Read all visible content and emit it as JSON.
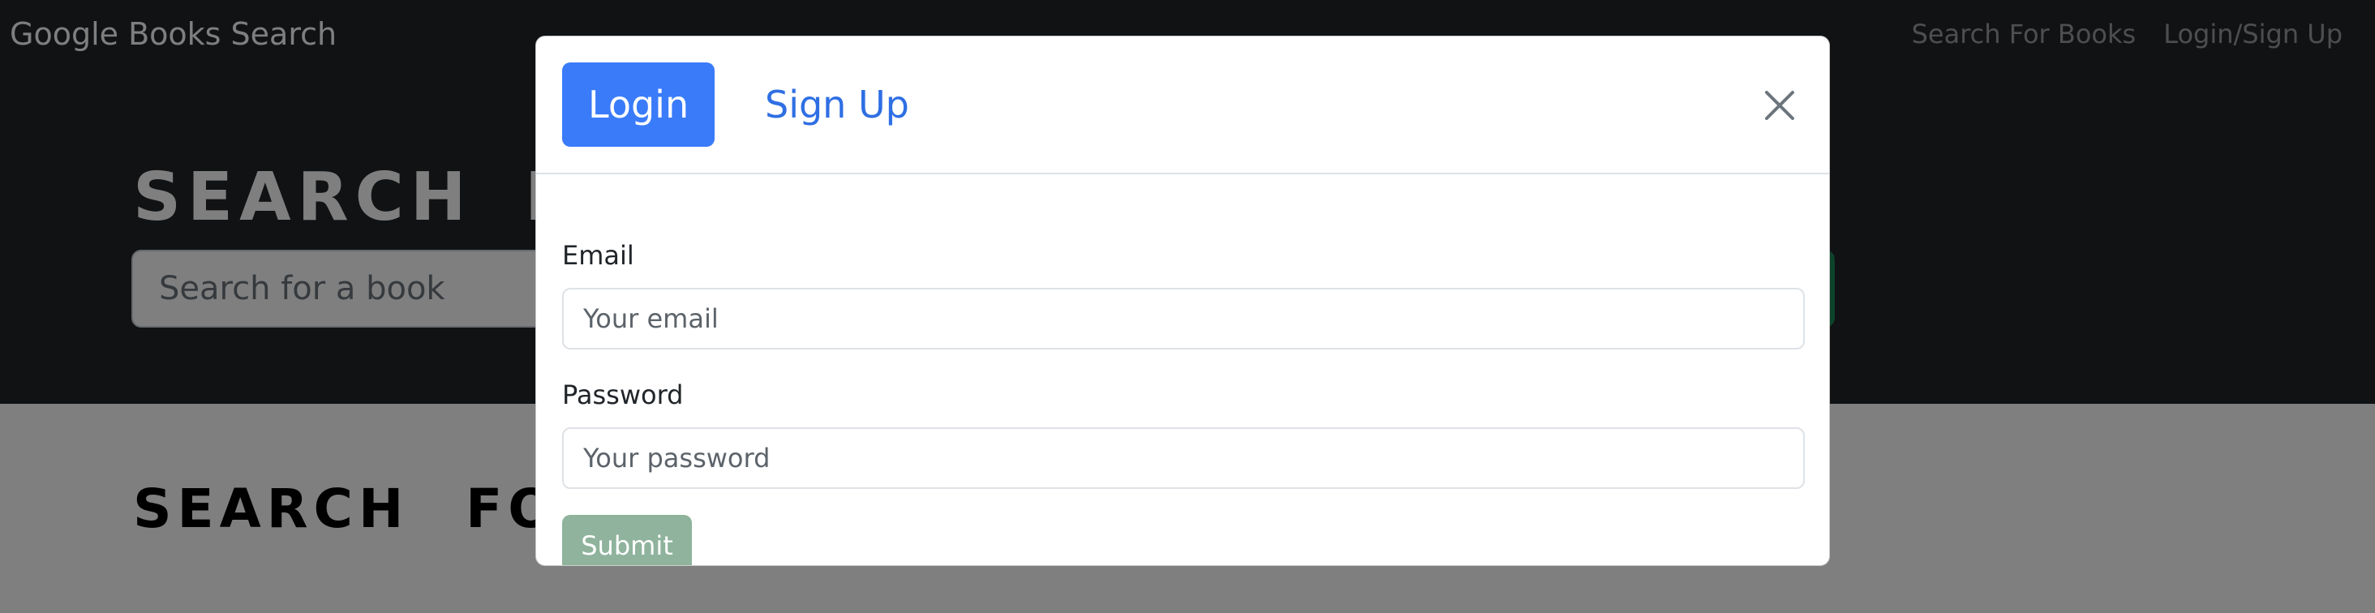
{
  "navbar": {
    "brand": "Google Books Search",
    "links": [
      "Search For Books",
      "Login/Sign Up"
    ]
  },
  "hero": {
    "title": "SEARCH FOR BOOKS!",
    "search_placeholder": "Search for a book"
  },
  "results": {
    "title": "SEARCH FOR A BOOK TO BEGIN"
  },
  "modal": {
    "tabs": [
      "Login",
      "Sign Up"
    ],
    "active_tab": "Login",
    "close_icon": "close-icon",
    "email_label": "Email",
    "email_placeholder": "Your email",
    "password_label": "Password",
    "password_placeholder": "Your password",
    "submit_label": "Submit"
  },
  "colors": {
    "navbar_bg": "#212529",
    "tab_active_bg": "#3a7bfa",
    "tab_link": "#2f6fe4",
    "submit_disabled_bg": "#8fb39c",
    "backdrop": "rgba(0,0,0,0.5)"
  }
}
